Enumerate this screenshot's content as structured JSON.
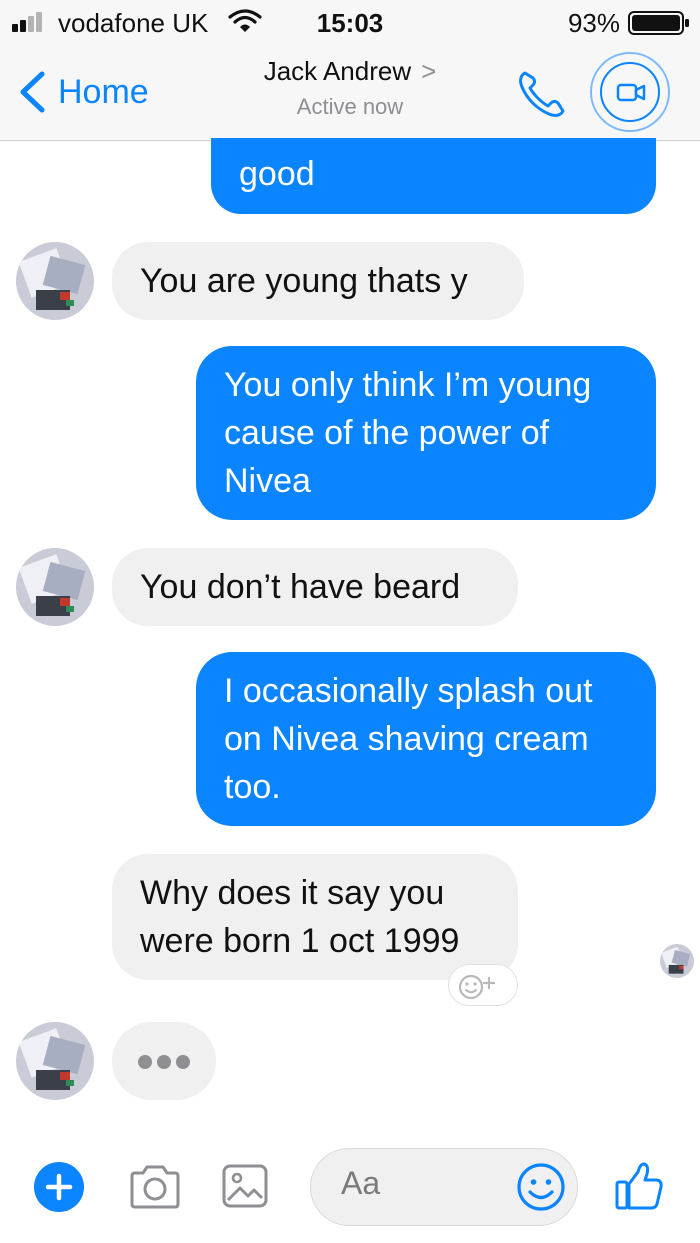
{
  "status_bar": {
    "carrier": "vodafone UK",
    "time": "15:03",
    "battery": "93%",
    "icons": [
      "signal-icon",
      "wifi-icon",
      "battery-icon"
    ]
  },
  "header": {
    "back_label": "Home",
    "contact_name": "Jack Andrew",
    "name_chevron": ">",
    "status": "Active now",
    "icons": [
      "back-chevron-icon",
      "phone-icon",
      "video-call-icon"
    ],
    "accent_color": "#0a84ff"
  },
  "messages": [
    {
      "sender": "me",
      "text": "good"
    },
    {
      "sender": "them",
      "text": "You are young thats y"
    },
    {
      "sender": "me",
      "lines": [
        "You only think I’m young",
        "cause of the power of",
        "Nivea"
      ]
    },
    {
      "sender": "them",
      "text": "You don’t have beard"
    },
    {
      "sender": "me",
      "lines": [
        "I occasionally splash out",
        "on Nivea shaving cream",
        "too."
      ]
    },
    {
      "sender": "them",
      "lines": [
        "Why does it say you",
        "were born 1 oct 1999"
      ]
    }
  ],
  "typing_indicator": true,
  "composer": {
    "placeholder": "Aa",
    "icons": [
      "plus-icon",
      "camera-icon",
      "image-icon",
      "emoji-icon",
      "thumbs-up-icon"
    ]
  },
  "colors": {
    "sent_bubble": "#0b84ff",
    "received_bubble": "#f0f0f0"
  }
}
